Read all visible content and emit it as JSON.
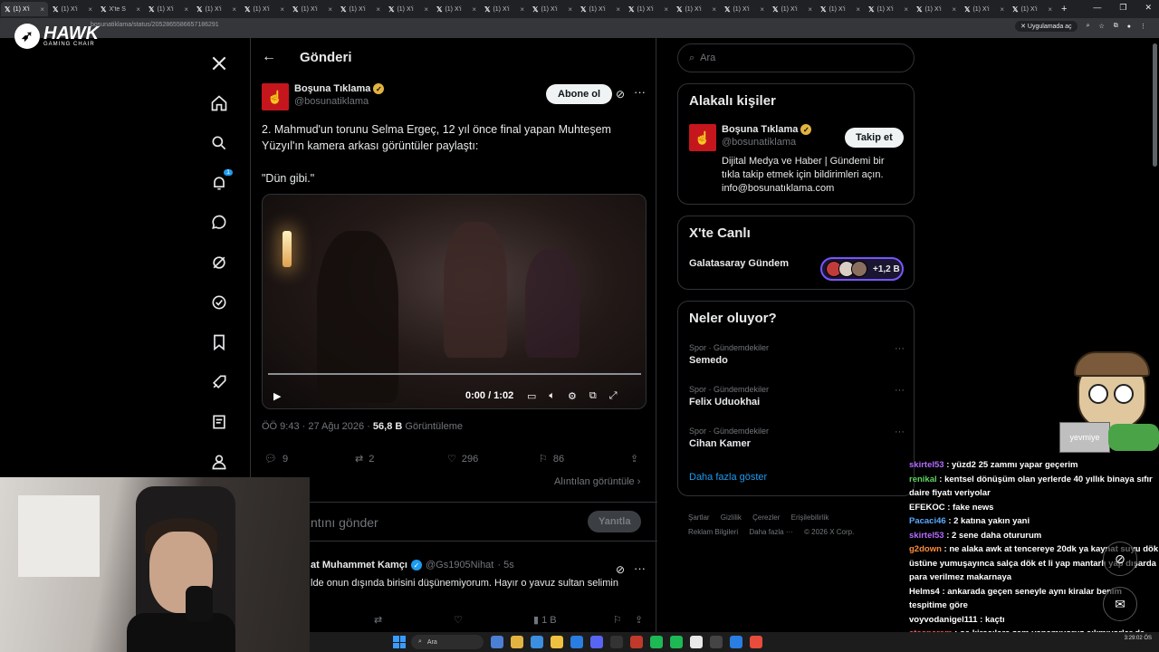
{
  "browser": {
    "tabs": [
      {
        "label": "(1) X'i"
      },
      {
        "label": "(1) X'i"
      },
      {
        "label": "X'te S"
      },
      {
        "label": "(1) X'i"
      },
      {
        "label": "(1) X'i"
      },
      {
        "label": "(1) X'i"
      },
      {
        "label": "(1) X'i"
      },
      {
        "label": "(1) X'i"
      },
      {
        "label": "(1) X'i"
      },
      {
        "label": "(1) X'i"
      },
      {
        "label": "(1) X'i"
      },
      {
        "label": "(1) X'i"
      },
      {
        "label": "(1) X'i"
      },
      {
        "label": "(1) X'i"
      },
      {
        "label": "(1) X'i"
      },
      {
        "label": "(1) X'i"
      },
      {
        "label": "(1) X'i"
      },
      {
        "label": "(1) X'i"
      },
      {
        "label": "(1) X'i"
      },
      {
        "label": "(1) X'i"
      },
      {
        "label": "(1) X'i"
      },
      {
        "label": "(1) X'i"
      }
    ],
    "url": "bosunatiklama/status/2052865586657186291",
    "app_pill": "Uygulamada aç"
  },
  "overlay": {
    "brand": "HAWK",
    "brand_sub": "GAMING CHAIR",
    "mascot_label": "yevmiye"
  },
  "nav": {
    "notification_count": "1"
  },
  "header": {
    "title": "Gönderi"
  },
  "tweet": {
    "author_name": "Boşuna Tıklama",
    "author_handle": "@bosunatiklama",
    "subscribe_label": "Abone ol",
    "text_line1": "2. Mahmud'un torunu Selma Ergeç, 12 yıl önce final yapan Muhteşem Yüzyıl'ın kamera arkası görüntüler paylaştı:",
    "text_line2": "\"Dün gibi.\"",
    "video_time": "0:00 / 1:02",
    "timestamp": "ÖÖ 9:43 · 27 Ağu 2026 · ",
    "views_count": "56,8 B",
    "views_label": " Görüntüleme",
    "replies": "9",
    "reposts": "2",
    "likes": "296",
    "bookmarks": "86",
    "quotes_link": "Alıntılan görüntüle ›"
  },
  "reply_box": {
    "placeholder": "ntını gönder",
    "button": "Yanıtla"
  },
  "reply": {
    "name": "at Muhammet Kamçı",
    "handle": "@Gs1905Nihat",
    "time": "· 5s",
    "text": "lde onun dışında birisini düşünemiyorum. Hayır o yavuz sultan selimin",
    "views": "1 B"
  },
  "right": {
    "search_placeholder": "Ara",
    "related_title": "Alakalı kişiler",
    "related": {
      "name": "Boşuna Tıklama",
      "handle": "@bosunatiklama",
      "follow": "Takip et",
      "bio": "Dijital Medya ve Haber | Gündemi bir tıkla takip etmek için bildirimleri açın. info@bosunatıklama.com"
    },
    "live_title": "X'te Canlı",
    "live_name": "Galatasaray Gündem",
    "live_count": "+1,2 B",
    "trends_title": "Neler oluyor?",
    "trends": [
      {
        "cat": "Spor · Gündemdekiler",
        "name": "Semedo"
      },
      {
        "cat": "Spor · Gündemdekiler",
        "name": "Felix Uduokhai"
      },
      {
        "cat": "Spor · Gündemdekiler",
        "name": "Cihan Kamer"
      }
    ],
    "show_more": "Daha fazla göster",
    "footer": [
      "Şartlar",
      "Gizlilik",
      "Çerezler",
      "Erişilebilirlik",
      "Reklam Bilgileri",
      "Daha fazla ···",
      "© 2026 X Corp."
    ]
  },
  "chat": [
    {
      "user": "skirtel53",
      "color": "#b46bff",
      "msg": ": yüzd2 25 zammı yapar geçerim"
    },
    {
      "user": "renikal",
      "color": "#5fd35f",
      "msg": ": kentsel dönüşüm olan yerlerde 40 yıllık binaya sıfır daire fiyatı veriyolar"
    },
    {
      "user": "EFEKOC",
      "color": "#ffffff",
      "msg": ": fake news"
    },
    {
      "user": "Pacaci46",
      "color": "#5aa9ff",
      "msg": ": 2 katına yakın yani"
    },
    {
      "user": "skirtel53",
      "color": "#b46bff",
      "msg": ": 2 sene daha otururum"
    },
    {
      "user": "g2down",
      "color": "#ff8c3a",
      "msg": ": ne alaka awk at tencereye 20dk ya kaynat suyu dök üstüne yumuşayınca salça dök et li yap mantarlı yap dışarda para verilmez makarnaya"
    },
    {
      "user": "Helms4",
      "color": "#ffffff",
      "msg": ": ankarada geçen seneyle aynı kiralar benim tespitime göre"
    },
    {
      "user": "voyvodanigel111",
      "color": "#ffffff",
      "msg": ": kaçtı"
    },
    {
      "user": "atesparem",
      "color": "#ff5a5a",
      "msg": ": oe kiracılara zam yapamıyoruz çıkmıyorlar da"
    }
  ],
  "taskbar": {
    "search": "Ara",
    "time": "3:29:02 ÖS"
  }
}
